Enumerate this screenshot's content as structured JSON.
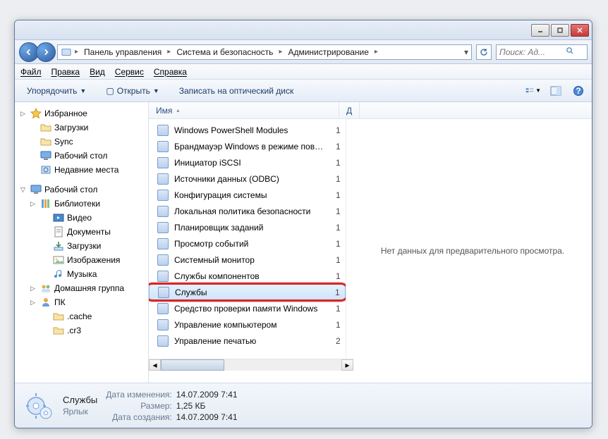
{
  "titlebar": {
    "minimize": "_",
    "maximize": "□",
    "close": "×"
  },
  "breadcrumbs": [
    "Панель управления",
    "Система и безопасность",
    "Администрирование"
  ],
  "search": {
    "placeholder": "Поиск: Ад..."
  },
  "menu": {
    "file": "Файл",
    "edit": "Правка",
    "view": "Вид",
    "tools": "Сервис",
    "help": "Справка"
  },
  "toolbar": {
    "organize": "Упорядочить",
    "open": "Открыть",
    "burn": "Записать на оптический диск"
  },
  "columns": {
    "name": "Имя",
    "date": "Д"
  },
  "preview_text": "Нет данных для предварительного просмотра.",
  "sidebar": [
    {
      "label": "Избранное",
      "icon": "star-icon",
      "lvl": 0,
      "exp": "▷"
    },
    {
      "label": "Загрузки",
      "icon": "folder-icon",
      "lvl": 1
    },
    {
      "label": "Sync",
      "icon": "folder-icon",
      "lvl": 1
    },
    {
      "label": "Рабочий стол",
      "icon": "desktop-icon",
      "lvl": 1
    },
    {
      "label": "Недавние места",
      "icon": "recent-icon",
      "lvl": 1
    },
    {
      "sep": true
    },
    {
      "label": "Рабочий стол",
      "icon": "desktop-icon",
      "lvl": 0,
      "exp": "▽"
    },
    {
      "label": "Библиотеки",
      "icon": "libraries-icon",
      "lvl": 1,
      "exp": "▷"
    },
    {
      "label": "Видео",
      "icon": "video-icon",
      "lvl": 2
    },
    {
      "label": "Документы",
      "icon": "documents-icon",
      "lvl": 2
    },
    {
      "label": "Загрузки",
      "icon": "downloads-icon",
      "lvl": 2
    },
    {
      "label": "Изображения",
      "icon": "images-icon",
      "lvl": 2
    },
    {
      "label": "Музыка",
      "icon": "music-icon",
      "lvl": 2
    },
    {
      "label": "Домашняя группа",
      "icon": "homegroup-icon",
      "lvl": 1,
      "exp": "▷"
    },
    {
      "label": "ПК",
      "icon": "user-icon",
      "lvl": 1,
      "exp": "▷"
    },
    {
      "label": ".cache",
      "icon": "folder-icon",
      "lvl": 2
    },
    {
      "label": ".cr3",
      "icon": "folder-icon",
      "lvl": 2
    }
  ],
  "files": [
    {
      "name": "Windows PowerShell Modules",
      "d": "1"
    },
    {
      "name": "Брандмауэр Windows в режиме повы...",
      "d": "1"
    },
    {
      "name": "Инициатор iSCSI",
      "d": "1"
    },
    {
      "name": "Источники данных (ODBC)",
      "d": "1"
    },
    {
      "name": "Конфигурация системы",
      "d": "1"
    },
    {
      "name": "Локальная политика безопасности",
      "d": "1"
    },
    {
      "name": "Планировщик заданий",
      "d": "1"
    },
    {
      "name": "Просмотр событий",
      "d": "1"
    },
    {
      "name": "Системный монитор",
      "d": "1"
    },
    {
      "name": "Службы компонентов",
      "d": "1"
    },
    {
      "name": "Службы",
      "d": "1",
      "selected": true,
      "highlight": true
    },
    {
      "name": "Средство проверки памяти Windows",
      "d": "1"
    },
    {
      "name": "Управление компьютером",
      "d": "1"
    },
    {
      "name": "Управление печатью",
      "d": "2"
    }
  ],
  "details": {
    "title": "Службы",
    "type": "Ярлык",
    "rows": [
      {
        "label": "Дата изменения:",
        "value": "14.07.2009 7:41"
      },
      {
        "label": "Размер:",
        "value": "1,25 КБ"
      },
      {
        "label": "Дата создания:",
        "value": "14.07.2009 7:41"
      }
    ]
  }
}
